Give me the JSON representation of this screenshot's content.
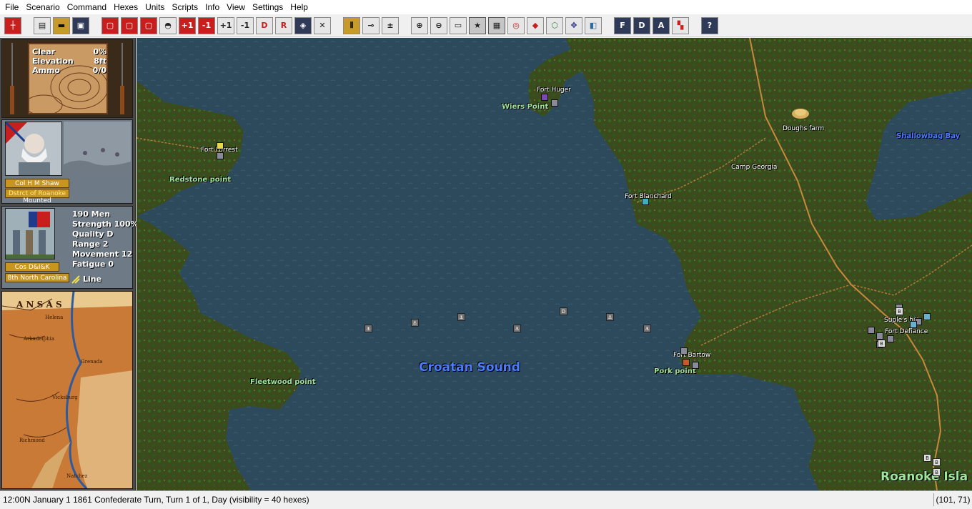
{
  "menu": [
    "File",
    "Scenario",
    "Command",
    "Hexes",
    "Units",
    "Scripts",
    "Info",
    "View",
    "Settings",
    "Help"
  ],
  "toolbar": {
    "buttons": [
      {
        "name": "crosshair-icon",
        "glyph": "┼"
      },
      {
        "name": "new-icon",
        "glyph": "▤"
      },
      {
        "name": "open-folder-icon",
        "glyph": "▬"
      },
      {
        "name": "save-icon",
        "glyph": "▣"
      },
      {
        "name": "red-toggle-1-icon",
        "glyph": "▢"
      },
      {
        "name": "red-toggle-2-icon",
        "glyph": "▢"
      },
      {
        "name": "red-toggle-3-icon",
        "glyph": "▢"
      },
      {
        "name": "helmet-icon",
        "glyph": "◓"
      },
      {
        "name": "plus-one-red",
        "glyph": "+1"
      },
      {
        "name": "minus-one-red",
        "glyph": "-1"
      },
      {
        "name": "plus-one",
        "glyph": "+1"
      },
      {
        "name": "minus-one",
        "glyph": "-1"
      },
      {
        "name": "d-icon",
        "glyph": "D"
      },
      {
        "name": "r-icon",
        "glyph": "R"
      },
      {
        "name": "shield-icon",
        "glyph": "◈"
      },
      {
        "name": "close-x-icon",
        "glyph": "✕"
      },
      {
        "name": "stripes-icon",
        "glyph": "⦀"
      },
      {
        "name": "cannon-icon",
        "glyph": "⊸"
      },
      {
        "name": "plus-list-icon",
        "glyph": "±"
      },
      {
        "name": "zoom-in-icon",
        "glyph": "⊕"
      },
      {
        "name": "zoom-out-icon",
        "glyph": "⊖"
      },
      {
        "name": "monitor-icon",
        "glyph": "▭"
      },
      {
        "name": "star-icon",
        "glyph": "★"
      },
      {
        "name": "grid-icon",
        "glyph": "▦"
      },
      {
        "name": "target-icon",
        "glyph": "◎"
      },
      {
        "name": "diamond-icon",
        "glyph": "◆"
      },
      {
        "name": "hexagon-icon",
        "glyph": "⬡"
      },
      {
        "name": "move-icon",
        "glyph": "✥"
      },
      {
        "name": "map-icon",
        "glyph": "◧"
      },
      {
        "name": "f-icon",
        "glyph": "F"
      },
      {
        "name": "d-box-icon",
        "glyph": "D"
      },
      {
        "name": "a-icon",
        "glyph": "A"
      },
      {
        "name": "flags-icon",
        "glyph": "▚"
      },
      {
        "name": "help-icon",
        "glyph": "?"
      }
    ]
  },
  "terrain": {
    "rows": [
      {
        "label": "Clear",
        "value": "0%"
      },
      {
        "label": "Elevation",
        "value": "8ft"
      },
      {
        "label": "Ammo",
        "value": "0/0"
      }
    ]
  },
  "leader": {
    "name": "Col H M Shaw",
    "command": "Dstrct of Roanoke",
    "mode": "Mounted"
  },
  "unit": {
    "name": "Cos D&I&K",
    "regiment": "8th North Carolina",
    "stats": [
      "190 Men",
      "Strength 100%",
      "Quality D",
      "Range 2",
      "Movement 12",
      "Fatigue 0"
    ],
    "formation": "Line"
  },
  "map": {
    "labels": [
      {
        "text": "Fort Huger",
        "style": "white"
      },
      {
        "text": "Wiers Point",
        "style": "green"
      },
      {
        "text": "Fort Forrest",
        "style": "white"
      },
      {
        "text": "Redstone point",
        "style": "green"
      },
      {
        "text": "Doughs farm",
        "style": "white"
      },
      {
        "text": "Shallowbag Bay",
        "style": "blue"
      },
      {
        "text": "Camp Georgia",
        "style": "white"
      },
      {
        "text": "Fort Blanchard",
        "style": "white"
      },
      {
        "text": "Suple's hill",
        "style": "white"
      },
      {
        "text": "Fort Defiance",
        "style": "white"
      },
      {
        "text": "Fort Bartow",
        "style": "white"
      },
      {
        "text": "Pork point",
        "style": "green"
      },
      {
        "text": "Fleetwood point",
        "style": "green"
      },
      {
        "text": "Croatan Sound",
        "style": "blue"
      },
      {
        "text": "Roanoke Isla",
        "style": "green"
      }
    ],
    "markers": [
      "⚓",
      "⚓",
      "⚓",
      "⚓",
      "D",
      "⚓",
      "⚓"
    ],
    "counters": [
      "B",
      "B",
      "B",
      "B",
      "B"
    ]
  },
  "colors": {
    "water": "#2d4a5c",
    "land": "#3c4a1e",
    "forest": "#2f5a1c",
    "road": "#c9893c",
    "label_green": "#9fe59a",
    "label_blue": "#4a7cff"
  },
  "status": {
    "text": "12:00N  January 1 1861  Confederate Turn, Turn 1 of 1, Day (visibility = 40 hexes)",
    "coords": "(101, 71)"
  }
}
